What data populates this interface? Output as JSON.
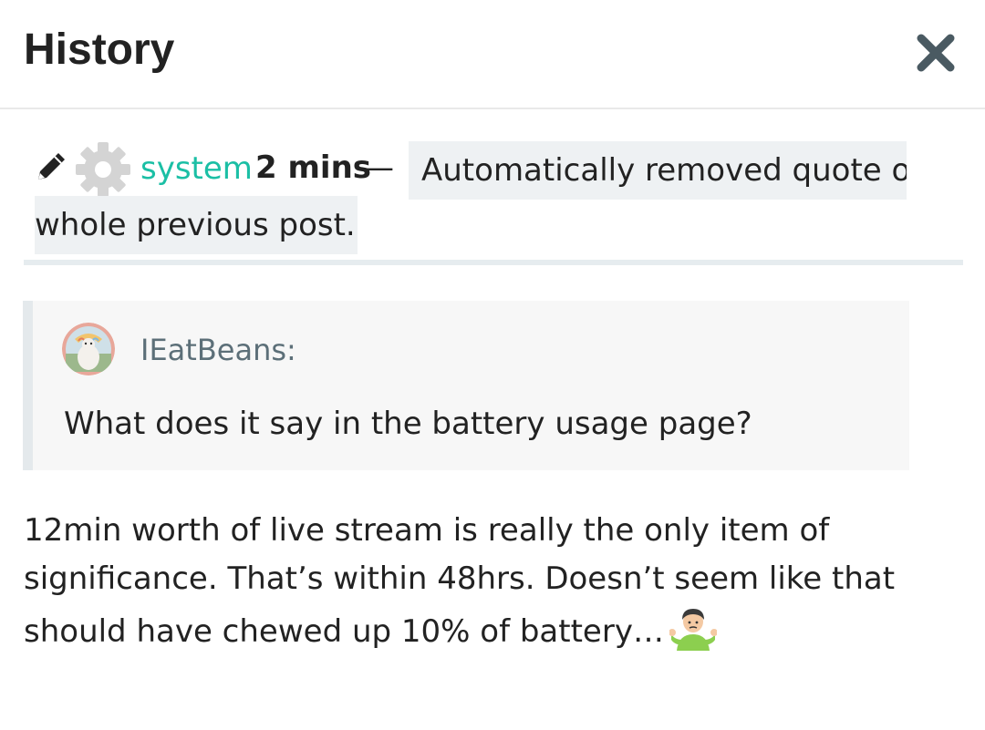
{
  "header": {
    "title": "History",
    "close_icon": "close-icon"
  },
  "revision": {
    "edit_icon": "pencil-icon",
    "avatar_icon": "gear-icon",
    "user": "system",
    "time": "2 mins",
    "separator": "—",
    "reason_line1": "Automatically removed quote of",
    "reason_line2": "whole previous post."
  },
  "quote": {
    "username": "IEatBeans:",
    "text": "What does it say in the battery usage page?"
  },
  "body": {
    "text": "12min worth of live stream is really the only item of significance. That’s within 48hrs. Doesn’t seem like that should have chewed up 10% of battery…",
    "emoji": "person-shrugging-emoji"
  },
  "colors": {
    "username": "#1bbfa5",
    "reason_bg": "#eef1f3",
    "quote_bg": "#f7f7f7",
    "close": "#4a5a62"
  }
}
